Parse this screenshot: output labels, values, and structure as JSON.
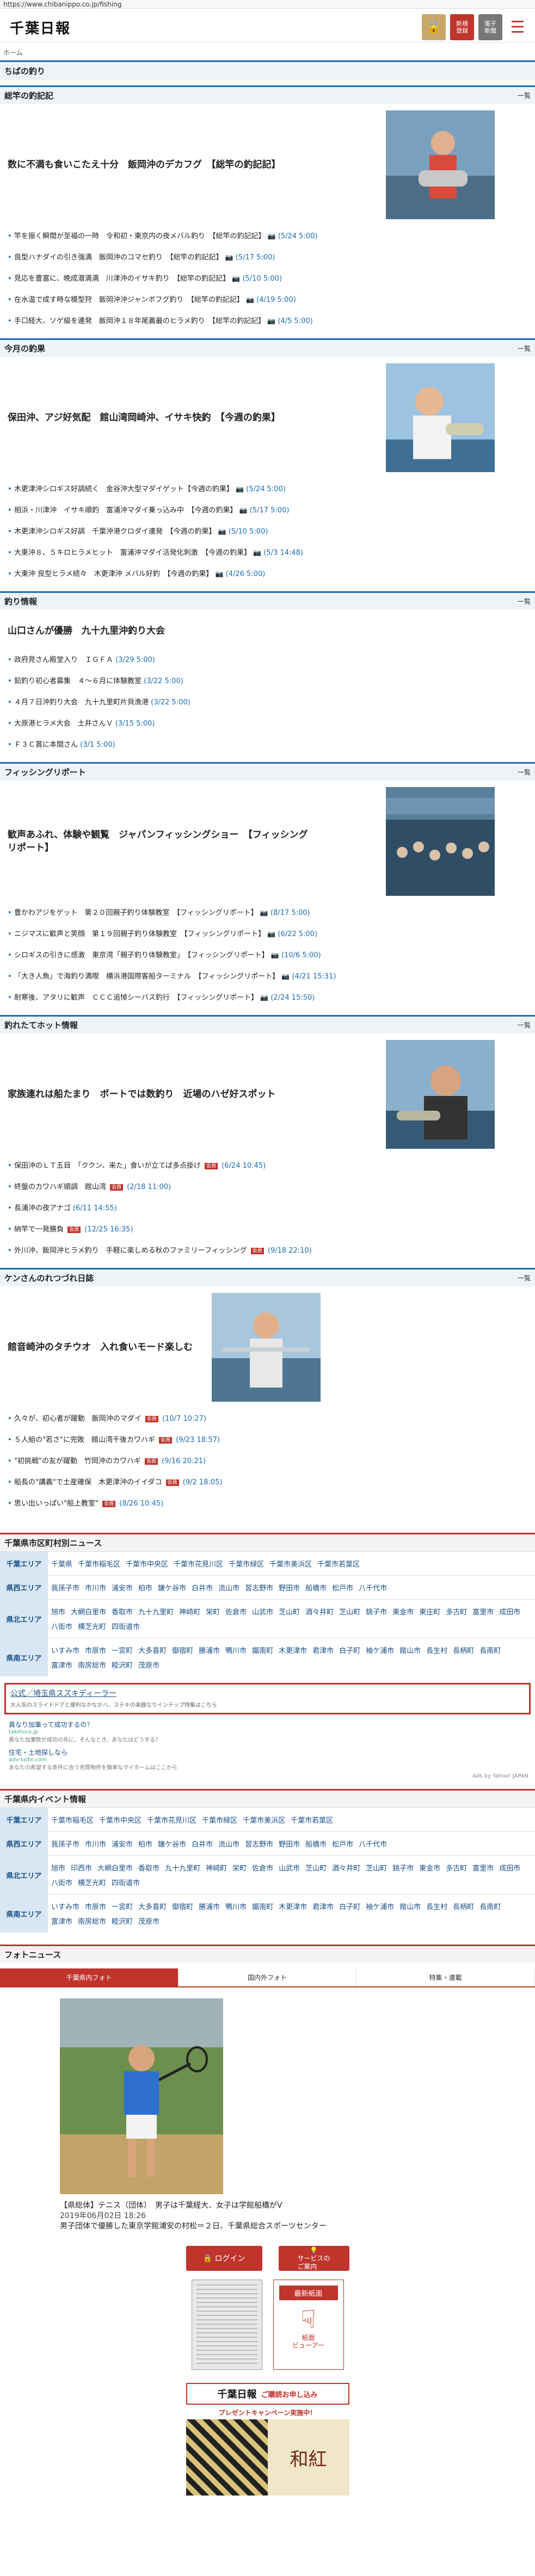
{
  "url": "https://www.chibanippo.co.jp/fishing",
  "header": {
    "logo": "千葉日報",
    "btn_register": "新規\n登録",
    "btn_epaper": "電子\n新聞",
    "menu_icon": "☰"
  },
  "breadcrumb": "ホーム",
  "page_title": "ちばの釣り",
  "more_label": "一覧",
  "sections": [
    {
      "title": "総竿の釣記記",
      "top": "数に不満も食いこたえ十分　飯岡沖のデカフグ　【総竿の釣記記】",
      "items": [
        {
          "text": "竿を振く瞬間が至福の一時　令和初・東京内の夜メバル釣り　【総竿の釣記記】",
          "date": "(5/24 5:00)"
        },
        {
          "text": "良型ハナダイの引き強満　飯岡沖のコマセ釣り　【総竿の釣記記】",
          "date": "(5/17 5:00)"
        },
        {
          "text": "見応を豊富に、晩成潜満満　川津沖のイサキ釣り　【総竿の釣記記】",
          "date": "(5/10 5:00)"
        },
        {
          "text": "在水温で成す時な模型狩　飯岡沖沖ジャンボフグ釣り　【総竿の釣記記】",
          "date": "(4/19 5:00)"
        },
        {
          "text": "手口経大、ソゲ級を連発　飯岡沖１８年尾義最のヒラメ釣り　【総竿の釣記記】",
          "date": "(4/5 5:00)"
        }
      ]
    },
    {
      "title": "今月の釣果",
      "top": "保田沖、アジ好気配　館山湾岡崎沖、イサキ快釣　【今週の釣果】",
      "items": [
        {
          "text": "木更津沖シロギス好調続く　金谷沖大型マダイゲット【今週の釣果】",
          "date": "(5/24 5:00)"
        },
        {
          "text": "相浜・川津沖　イサキ順釣　富浦沖マダイ乗っ込み中　【今週の釣果】",
          "date": "(5/17 5:00)"
        },
        {
          "text": "木更津沖シロギス好調　千葉沖港クロダイ連発　【今週の釣果】",
          "date": "(5/10 5:00)"
        },
        {
          "text": "大東沖８、５キロヒラメヒット　富浦沖マダイ活発化刺激　【今週の釣果】",
          "date": "(5/3 14:48)"
        },
        {
          "text": "大東沖 良型ヒラメ続々　木更津沖 メバル好釣　【今週の釣果】",
          "date": "(4/26 5:00)"
        }
      ]
    },
    {
      "title": "釣り情報",
      "top": "山口さんが優勝　九十九里沖釣り大会",
      "items": [
        {
          "text": "政府見さん殿堂入り　ＩＧＦＡ",
          "date": "(3/29 5:00)"
        },
        {
          "text": "鉛釣り初心者募集　４～６月に体験教室",
          "date": "(3/22 5:00)"
        },
        {
          "text": "４月７日沖釣り大会　九十九里町片貝漁港",
          "date": "(3/22 5:00)"
        },
        {
          "text": "大原港ヒラメ大会　土井さんＶ",
          "date": "(3/15 5:00)"
        },
        {
          "text": "Ｆ３Ｃ賞に本間さん",
          "date": "(3/1 5:00)"
        }
      ]
    },
    {
      "title": "フィッシングリポート",
      "top": "歓声あふれ、体験や観覧　ジャパンフィッシングショー　【フィッシングリポート】",
      "items": [
        {
          "text": "豊かわアジをゲット　第２０回親子釣り体験教室　【フィッシングリポート】",
          "date": "(8/17 5:00)"
        },
        {
          "text": "ニジマスに歓声と笑顔　第１９回親子釣り体験教室　【フィッシングリポート】",
          "date": "(6/22 5:00)"
        },
        {
          "text": "シロギスの引きに感激　東京湾「親子釣り体験教室」　【フィッシングリポート】",
          "date": "(10/6 5:00)"
        },
        {
          "text": "「大き人魚」で海釣り満喫　横浜港国際客船ターミナル　【フィッシングリポート】",
          "date": "(4/21 15:31)"
        },
        {
          "text": "耐寒後、アタリに歓声　ＣＣＣ追悼シーバス釣行　【フィッシングリポート】",
          "date": "(2/24 15:50)"
        }
      ]
    },
    {
      "title": "釣れたてホット情報",
      "top": "家族連れは船たまり　ボートでは数釣り　近場のハゼ好スポット",
      "items": [
        {
          "text": "保田沖のＬＴ五目　「ククン、来た」食いが立てば多点掛け",
          "date": "(6/24 10:45)"
        },
        {
          "text": "終盤のカワハギ順調　館山湾",
          "date": "(2/18 11:00)"
        },
        {
          "text": "長浦沖の夜アナゴ",
          "date": "(6/11 14:55)"
        },
        {
          "text": "納竿で一発勝負",
          "date": "(12/25 16:35)"
        },
        {
          "text": "外川沖、飯岡沖ヒラメ釣り　手軽に楽しめる秋のファミリーフィッシング",
          "date": "(9/18 22:10)"
        }
      ]
    },
    {
      "title": "ケンさんのれつづれ日誌",
      "top": "館音崎沖のタチウオ　入れ食いモード楽しむ",
      "items": [
        {
          "text": "久々が、初心者が躍動　飯岡沖のマダイ",
          "date": "(10/7 10:27)"
        },
        {
          "text": "５人組の\"若さ\"に完敗　館山湾千後カワハギ",
          "date": "(9/23 18:57)"
        },
        {
          "text": "\"初挑戦\"の友が躍動　竹岡沖のカワハギ",
          "date": "(9/16 20:21)"
        },
        {
          "text": "船長の\"講義\"で土産確保　木更津沖のイイダコ",
          "date": "(9/2 18:05)"
        },
        {
          "text": "思い出いっぱい\"船上教室\"",
          "date": "(8/26 10:45)"
        }
      ]
    }
  ],
  "city_news": {
    "title": "千葉県市区町村別ニュース",
    "areas": [
      {
        "label": "千葉エリア",
        "cities": [
          "千葉県",
          "千葉市稲毛区",
          "千葉市中央区",
          "千葉市花見川区",
          "千葉市緑区",
          "千葉市美浜区",
          "千葉市若葉区"
        ]
      },
      {
        "label": "県西エリア",
        "cities": [
          "我孫子市",
          "市川市",
          "浦安市",
          "柏市",
          "鎌ケ谷市",
          "白井市",
          "流山市",
          "習志野市",
          "野田市",
          "船橋市",
          "松戸市",
          "八千代市"
        ]
      },
      {
        "label": "県北エリア",
        "cities": [
          "旭市",
          "大網白里市",
          "香取市",
          "九十九里町",
          "神崎町",
          "栄町",
          "佐倉市",
          "山武市",
          "芝山町",
          "酒々井町",
          "芝山町",
          "銚子市",
          "東金市",
          "東庄町",
          "多古町",
          "富里市",
          "成田市",
          "八街市",
          "横芝光町",
          "四街道市"
        ]
      },
      {
        "label": "県南エリア",
        "cities": [
          "いすみ市",
          "市原市",
          "一宮町",
          "大多喜町",
          "御宿町",
          "勝浦市",
          "鴨川市",
          "鋸南町",
          "木更津市",
          "君津市",
          "白子町",
          "袖ケ浦市",
          "館山市",
          "長生村",
          "長柄町",
          "長南町",
          "富津市",
          "南房総市",
          "睦沢町",
          "茂原市"
        ]
      }
    ]
  },
  "ads": {
    "main_title": "公式／埼玉県スズキディーラー",
    "main_desc": "大人気のスライドドアと便利なかなかハ、ステキの楽器なりインテップ特集はこちら",
    "small": [
      {
        "title": "異なり加筆って成功するの？",
        "source": "taketora.jp",
        "desc": "異なた加筆数が成功の先に。そんなとき、あなたはどうする？"
      },
      {
        "title": "住宅・土地探しなら",
        "source": "adv-ssite.com",
        "desc": "あなたの希望する条件に合う売買物件を簡単なマイホームはここから"
      }
    ],
    "ads_by": "Ads by Yahoo! JAPAN"
  },
  "event_info": {
    "title": "千葉県内イベント情報",
    "areas": [
      {
        "label": "千葉エリア",
        "cities": [
          "千葉市稲毛区",
          "千葉市中央区",
          "千葉市花見川区",
          "千葉市緑区",
          "千葉市美浜区",
          "千葉市若葉区"
        ]
      },
      {
        "label": "県西エリア",
        "cities": [
          "我孫子市",
          "市川市",
          "浦安市",
          "柏市",
          "鎌ケ谷市",
          "白井市",
          "流山市",
          "習志野市",
          "野田市",
          "船橋市",
          "松戸市",
          "八千代市"
        ]
      },
      {
        "label": "県北エリア",
        "cities": [
          "旭市",
          "印西市",
          "大網白里市",
          "香取市",
          "九十九里町",
          "神崎町",
          "栄町",
          "佐倉市",
          "山武市",
          "芝山町",
          "酒々井町",
          "芝山町",
          "銚子市",
          "東金市",
          "多古町",
          "富里市",
          "成田市",
          "八街市",
          "横芝光町",
          "四街道市"
        ]
      },
      {
        "label": "県南エリア",
        "cities": [
          "いすみ市",
          "市原市",
          "一宮町",
          "大多喜町",
          "御宿町",
          "勝浦市",
          "鴨川市",
          "鋸南町",
          "木更津市",
          "君津市",
          "白子町",
          "袖ケ浦市",
          "館山市",
          "長生村",
          "長柄町",
          "長南町",
          "富津市",
          "南房総市",
          "睦沢町",
          "茂原市"
        ]
      }
    ]
  },
  "photo_news": {
    "title": "フォトニュース",
    "tabs": [
      "千葉県内フォト",
      "国内外フォト",
      "特集・連載"
    ],
    "caption": "【県総体】テニス（団体）　男子は千葉経大、女子は学館船橋がV",
    "date": "2019年06月02日 18:26",
    "desc": "男子団体で優勝した東京学館浦安の村松＝２日、千葉県総合スポーツセンター"
  },
  "footer": {
    "login": "ログイン",
    "service": "サービスの\nご案内",
    "viewer_title": "最新紙面",
    "viewer_icon": "☟",
    "viewer_sub": "紙面\nビューアー",
    "banner_logo": "千葉日報",
    "banner_text": "ご購読お申し込み",
    "promo_text": "プレゼントキャンペーン実施中！",
    "promo_art": "和紅"
  }
}
